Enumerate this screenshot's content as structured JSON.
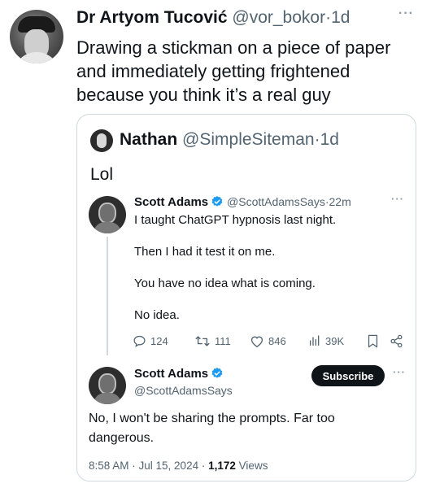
{
  "outer": {
    "name": "Dr Artyom Tucović",
    "handle": "@vor_bokor",
    "dot": "·",
    "time": "1d",
    "more": "···",
    "text": "Drawing a stickman on a piece of paper and immediately getting frightened because you think it’s a real guy"
  },
  "quote": {
    "name": "Nathan",
    "handle": "@SimpleSiteman",
    "dot": "·",
    "time": "1d",
    "text": "Lol"
  },
  "inner_post": {
    "name": "Scott Adams",
    "handle": "@ScottAdamsSays",
    "dot": "·",
    "time": "22m",
    "more": "···",
    "lines": [
      "I taught ChatGPT hypnosis last night.",
      "Then I had it test it on me.",
      "You have no idea what is coming.",
      "No idea."
    ],
    "actions": {
      "replies": "124",
      "reposts": "111",
      "likes": "846",
      "views": "39K"
    }
  },
  "reply_post": {
    "name": "Scott Adams",
    "handle": "@ScottAdamsSays",
    "subscribe_label": "Subscribe",
    "more": "···",
    "text": "No, I won't be sharing the prompts. Far too dangerous.",
    "timestamp": "8:58 AM · Jul 15, 2024 ·",
    "views_count": "1,172",
    "views_label": "Views"
  },
  "colors": {
    "verified": "#1d9bf0",
    "muted": "#536471",
    "border": "#cfd9de"
  },
  "icons": {
    "verified": "verified-badge-icon",
    "reply": "reply-icon",
    "repost": "repost-icon",
    "like": "heart-icon",
    "views": "views-icon",
    "bookmark": "bookmark-icon",
    "share": "share-icon"
  }
}
